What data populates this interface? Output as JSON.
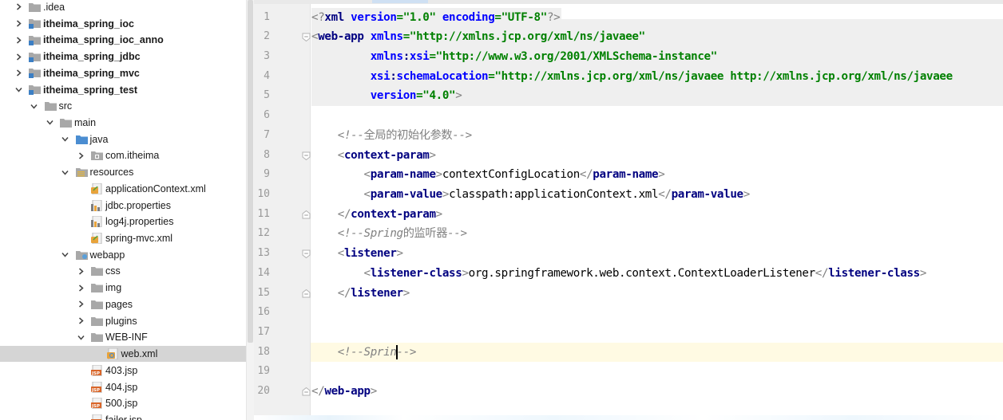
{
  "tree": {
    "items": [
      {
        "label": ".idea",
        "depth": 0,
        "arrow": "right",
        "icon": "folder-icon",
        "bold": false
      },
      {
        "label": "itheima_spring_ioc",
        "depth": 0,
        "arrow": "right",
        "icon": "module-folder-icon",
        "bold": true
      },
      {
        "label": "itheima_spring_ioc_anno",
        "depth": 0,
        "arrow": "right",
        "icon": "module-folder-icon",
        "bold": true
      },
      {
        "label": "itheima_spring_jdbc",
        "depth": 0,
        "arrow": "right",
        "icon": "module-folder-icon",
        "bold": true
      },
      {
        "label": "itheima_spring_mvc",
        "depth": 0,
        "arrow": "right",
        "icon": "module-folder-icon",
        "bold": true
      },
      {
        "label": "itheima_spring_test",
        "depth": 0,
        "arrow": "down",
        "icon": "module-folder-icon",
        "bold": true
      },
      {
        "label": "src",
        "depth": 1,
        "arrow": "down",
        "icon": "folder-icon",
        "bold": false
      },
      {
        "label": "main",
        "depth": 2,
        "arrow": "down",
        "icon": "folder-icon",
        "bold": false
      },
      {
        "label": "java",
        "depth": 3,
        "arrow": "down",
        "icon": "source-folder-icon",
        "bold": false
      },
      {
        "label": "com.itheima",
        "depth": 4,
        "arrow": "right",
        "icon": "package-icon",
        "bold": false
      },
      {
        "label": "resources",
        "depth": 3,
        "arrow": "down",
        "icon": "resources-folder-icon",
        "bold": false
      },
      {
        "label": "applicationContext.xml",
        "depth": 4,
        "arrow": "none",
        "icon": "spring-xml-icon",
        "bold": false
      },
      {
        "label": "jdbc.properties",
        "depth": 4,
        "arrow": "none",
        "icon": "properties-icon",
        "bold": false
      },
      {
        "label": "log4j.properties",
        "depth": 4,
        "arrow": "none",
        "icon": "properties-icon",
        "bold": false
      },
      {
        "label": "spring-mvc.xml",
        "depth": 4,
        "arrow": "none",
        "icon": "spring-xml-icon",
        "bold": false
      },
      {
        "label": "webapp",
        "depth": 3,
        "arrow": "down",
        "icon": "web-folder-icon",
        "bold": false
      },
      {
        "label": "css",
        "depth": 4,
        "arrow": "right",
        "icon": "folder-icon",
        "bold": false
      },
      {
        "label": "img",
        "depth": 4,
        "arrow": "right",
        "icon": "folder-icon",
        "bold": false
      },
      {
        "label": "pages",
        "depth": 4,
        "arrow": "right",
        "icon": "folder-icon",
        "bold": false
      },
      {
        "label": "plugins",
        "depth": 4,
        "arrow": "right",
        "icon": "folder-icon",
        "bold": false
      },
      {
        "label": "WEB-INF",
        "depth": 4,
        "arrow": "down",
        "icon": "folder-icon",
        "bold": false
      },
      {
        "label": "web.xml",
        "depth": 5,
        "arrow": "none",
        "icon": "web-xml-icon",
        "bold": false,
        "selected": true
      },
      {
        "label": "403.jsp",
        "depth": 4,
        "arrow": "none",
        "icon": "jsp-icon",
        "bold": false
      },
      {
        "label": "404.jsp",
        "depth": 4,
        "arrow": "none",
        "icon": "jsp-icon",
        "bold": false
      },
      {
        "label": "500.jsp",
        "depth": 4,
        "arrow": "none",
        "icon": "jsp-icon",
        "bold": false
      },
      {
        "label": "failer.jsp",
        "depth": 4,
        "arrow": "none",
        "icon": "jsp-icon",
        "bold": false
      }
    ]
  },
  "editor": {
    "current_line": 18,
    "lines": [
      {
        "n": 1,
        "fold": "",
        "hl": true,
        "indent": 0,
        "segs": [
          [
            "d",
            "<?"
          ],
          [
            "t",
            "xml "
          ],
          [
            "a",
            "version"
          ],
          [
            "v",
            "=\"1.0\" "
          ],
          [
            "a",
            "encoding"
          ],
          [
            "v",
            "=\"UTF-8\""
          ],
          [
            "d",
            "?>"
          ]
        ]
      },
      {
        "n": 2,
        "fold": "open",
        "hl": true,
        "indent": 0,
        "segs": [
          [
            "d",
            "<"
          ],
          [
            "t",
            "web-app "
          ],
          [
            "a",
            "xmlns"
          ],
          [
            "v",
            "=\"http://xmlns.jcp.org/xml/ns/javaee\""
          ]
        ]
      },
      {
        "n": 3,
        "fold": "",
        "hl": true,
        "indent": 9,
        "segs": [
          [
            "a",
            "xmlns"
          ],
          [
            "t",
            ":"
          ],
          [
            "a",
            "xsi"
          ],
          [
            "v",
            "=\"http://www.w3.org/2001/XMLSchema-instance\""
          ]
        ]
      },
      {
        "n": 4,
        "fold": "",
        "hl": true,
        "indent": 9,
        "segs": [
          [
            "a",
            "xsi"
          ],
          [
            "t",
            ":"
          ],
          [
            "a",
            "schemaLocation"
          ],
          [
            "v",
            "=\"http://xmlns.jcp.org/xml/ns/javaee http://xmlns.jcp.org/xml/ns/javaee"
          ]
        ]
      },
      {
        "n": 5,
        "fold": "",
        "hl": true,
        "indent": 9,
        "segs": [
          [
            "a",
            "version"
          ],
          [
            "v",
            "=\"4.0\""
          ],
          [
            "d",
            ">"
          ]
        ]
      },
      {
        "n": 6,
        "fold": "",
        "hl": false,
        "indent": 0,
        "segs": []
      },
      {
        "n": 7,
        "fold": "",
        "hl": false,
        "indent": 4,
        "segs": [
          [
            "c",
            "<!--"
          ],
          [
            "cc",
            "全局的初始化参数"
          ],
          [
            "c",
            "-->"
          ]
        ]
      },
      {
        "n": 8,
        "fold": "open",
        "hl": false,
        "indent": 4,
        "segs": [
          [
            "d",
            "<"
          ],
          [
            "t",
            "context-param"
          ],
          [
            "d",
            ">"
          ]
        ]
      },
      {
        "n": 9,
        "fold": "",
        "hl": false,
        "indent": 8,
        "segs": [
          [
            "d",
            "<"
          ],
          [
            "t",
            "param-name"
          ],
          [
            "d",
            ">"
          ],
          [
            "pl",
            "contextConfigLocation"
          ],
          [
            "d",
            "</"
          ],
          [
            "t",
            "param-name"
          ],
          [
            "d",
            ">"
          ]
        ]
      },
      {
        "n": 10,
        "fold": "",
        "hl": false,
        "indent": 8,
        "segs": [
          [
            "d",
            "<"
          ],
          [
            "t",
            "param-value"
          ],
          [
            "d",
            ">"
          ],
          [
            "pl",
            "classpath:applicationContext.xml"
          ],
          [
            "d",
            "</"
          ],
          [
            "t",
            "param-value"
          ],
          [
            "d",
            ">"
          ]
        ]
      },
      {
        "n": 11,
        "fold": "close",
        "hl": false,
        "indent": 4,
        "segs": [
          [
            "d",
            "</"
          ],
          [
            "t",
            "context-param"
          ],
          [
            "d",
            ">"
          ]
        ]
      },
      {
        "n": 12,
        "fold": "",
        "hl": false,
        "indent": 4,
        "segs": [
          [
            "c",
            "<!--Spring"
          ],
          [
            "cc",
            "的监听器"
          ],
          [
            "c",
            "-->"
          ]
        ]
      },
      {
        "n": 13,
        "fold": "open",
        "hl": false,
        "indent": 4,
        "segs": [
          [
            "d",
            "<"
          ],
          [
            "t",
            "listener"
          ],
          [
            "d",
            ">"
          ]
        ]
      },
      {
        "n": 14,
        "fold": "",
        "hl": false,
        "indent": 8,
        "segs": [
          [
            "d",
            "<"
          ],
          [
            "t",
            "listener-class"
          ],
          [
            "d",
            ">"
          ],
          [
            "pl",
            "org.springframework.web.context.ContextLoaderListener"
          ],
          [
            "d",
            "</"
          ],
          [
            "t",
            "listener-class"
          ],
          [
            "d",
            ">"
          ]
        ]
      },
      {
        "n": 15,
        "fold": "close",
        "hl": false,
        "indent": 4,
        "segs": [
          [
            "d",
            "</"
          ],
          [
            "t",
            "listener"
          ],
          [
            "d",
            ">"
          ]
        ]
      },
      {
        "n": 16,
        "fold": "",
        "hl": false,
        "indent": 0,
        "segs": []
      },
      {
        "n": 17,
        "fold": "",
        "hl": false,
        "indent": 0,
        "segs": []
      },
      {
        "n": 18,
        "fold": "",
        "hl": false,
        "indent": 4,
        "segs": [
          [
            "c",
            "<!--Sprin"
          ],
          [
            "caret",
            ""
          ],
          [
            "c",
            "-->"
          ]
        ]
      },
      {
        "n": 19,
        "fold": "",
        "hl": false,
        "indent": 0,
        "segs": []
      },
      {
        "n": 20,
        "fold": "close",
        "hl": false,
        "indent": 0,
        "segs": [
          [
            "d",
            "</"
          ],
          [
            "t",
            "web-app"
          ],
          [
            "d",
            ">"
          ]
        ]
      }
    ]
  },
  "colors": {
    "tag": "#000080",
    "attribute": "#0000ff",
    "value": "#008000",
    "comment": "#808080",
    "selection": "#d5d5d5",
    "current_line": "#fffae3"
  }
}
